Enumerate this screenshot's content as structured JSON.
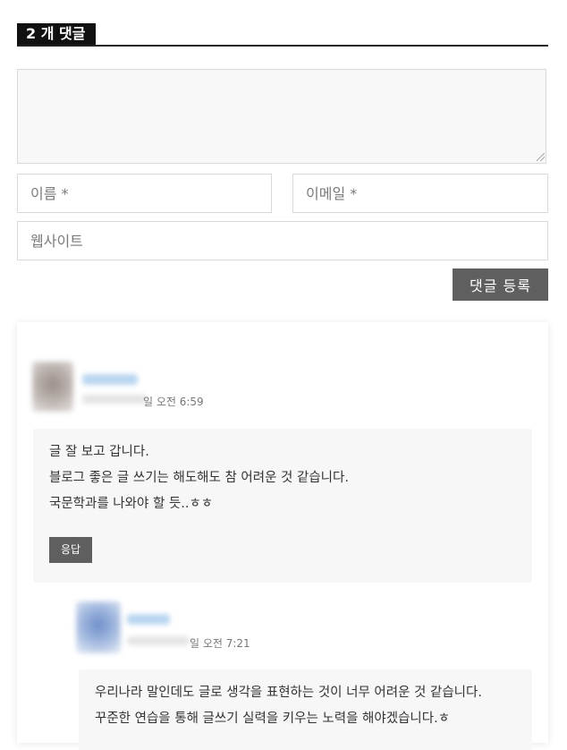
{
  "comments_section": {
    "title": "2 개 댓글"
  },
  "form": {
    "comment_value": "",
    "name_placeholder": "이름 *",
    "email_placeholder": "이메일 *",
    "website_placeholder": "웹사이트",
    "submit_label": "댓글 등록"
  },
  "comments": [
    {
      "date_tail": "일 오전 6:59",
      "lines": [
        "글 잘 보고 갑니다.",
        "블로그 좋은 글 쓰기는 해도해도 참 어려운 것 같습니다.",
        "국문학과를 나와야 할 듯..ㅎㅎ"
      ],
      "reply_label": "응답"
    },
    {
      "date_tail": "일 오전 7:21",
      "lines": [
        "우리나라 말인데도 글로 생각을 표현하는 것이 너무 어려운 것 같습니다.",
        "꾸준한 연습을 통해 글쓰기 실력을 키우는 노력을 해야겠습니다.ㅎ"
      ]
    }
  ],
  "colors": {
    "title_bg": "#111111",
    "button_bg": "#5f5f5f",
    "bubble_bg": "#f7f7f7",
    "textarea_bg": "#f8f8f8"
  }
}
